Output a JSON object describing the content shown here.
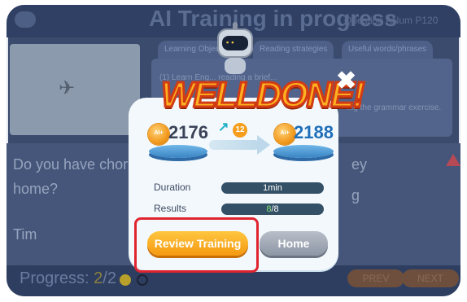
{
  "background": {
    "title": "AI Training in progress",
    "question_label": "Question ANum   P120",
    "tabs": [
      "Learning Objectives",
      "Reading strategies",
      "Useful words/phrases"
    ],
    "panel_line1": "(1) Learn Eng... reading a brief...",
    "panel_line2": "...g the grammar exercise.",
    "question_text_1": "Do you have chore",
    "question_text_2": "home?",
    "question_tail_1": "ey",
    "question_tail_2": "g",
    "speaker": "Tim",
    "progress_label": "Progress: ",
    "progress_current": "2",
    "progress_sep": "/2",
    "prev_label": "PREV",
    "next_label": "NEXT"
  },
  "dialog": {
    "banner": "WELLDONE!",
    "badge_label": "AI+",
    "old_score": "2176",
    "gain": "12",
    "new_score": "2188",
    "duration_label": "Duration",
    "duration_value": "1min",
    "results_label": "Results",
    "results_correct": "8",
    "results_total": "/8",
    "review_button": "Review Training",
    "home_button": "Home",
    "close_symbol": "✖"
  },
  "colors": {
    "accent_orange": "#f59a10",
    "score_blue": "#1f6fb8",
    "highlight_red": "#e0242f"
  }
}
